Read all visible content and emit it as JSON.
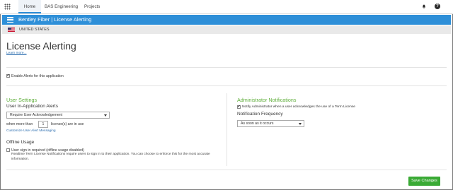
{
  "nav": {
    "tabs": [
      {
        "label": "Home"
      },
      {
        "label": "BAS Engineering"
      },
      {
        "label": "Projects"
      }
    ],
    "help_label": "?"
  },
  "header": {
    "title": "Bentley Fiber | License Alerting"
  },
  "region": {
    "country": "UNITED STATES"
  },
  "page": {
    "title": "License Alerting",
    "learn_more": "Learn more...",
    "enable_alerts_label": "Enable Alerts for this application",
    "enable_alerts_checked": true
  },
  "user_settings": {
    "title": "User Settings",
    "in_app_title": "User In-Application Alerts",
    "alert_type_value": "Require User Acknowledgement",
    "when_more_than": "when more than",
    "license_count": "1",
    "licenses_in_use": "license(s) are in use",
    "customize_link": "Customize User Alert Messaging",
    "offline_title": "Offline Usage",
    "offline_label": "User sign in required (offline usage disabled)",
    "offline_checked": false,
    "offline_desc": "Realtime Term License Notifications require users to sign in to their application. You can choose to enforce this for the most accurate information."
  },
  "admin": {
    "title": "Administrator Notifications",
    "notify_label": "Notify Administrator when a user acknowledges the use of a Term License",
    "notify_checked": true,
    "freq_title": "Notification Frequency",
    "freq_value": "As soon as it occurs"
  },
  "actions": {
    "save_label": "Save Changes"
  },
  "colors": {
    "accent": "#2e8fd8",
    "section_green": "#5fae3b",
    "save_green": "#3aaa35"
  }
}
